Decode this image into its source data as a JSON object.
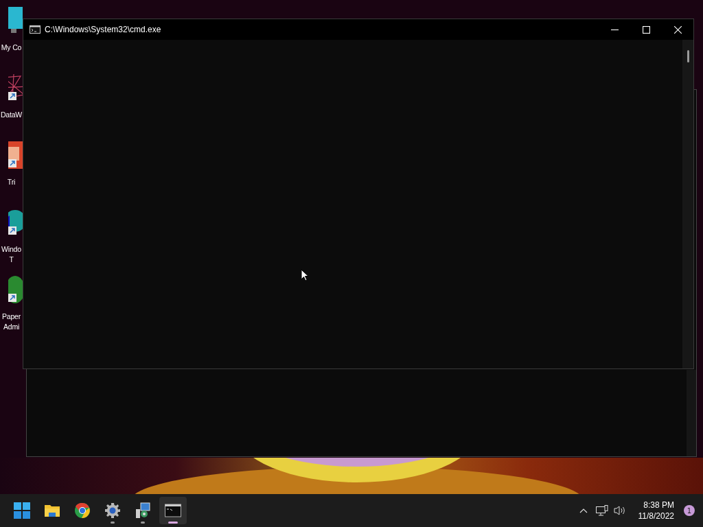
{
  "desktop_icons": [
    {
      "kind": "monitor",
      "shortcut": false,
      "lines": [
        "My Co"
      ]
    },
    {
      "kind": "network",
      "shortcut": true,
      "lines": [
        "DataW"
      ]
    },
    {
      "kind": "document",
      "shortcut": true,
      "lines": [
        "Tri"
      ]
    },
    {
      "kind": "globe",
      "shortcut": true,
      "lines": [
        "Windo",
        "T"
      ]
    },
    {
      "kind": "leaf",
      "shortcut": true,
      "lines": [
        "Paper",
        "Admi"
      ]
    }
  ],
  "window": {
    "title": "C:\\Windows\\System32\\cmd.exe"
  },
  "taskbar": {
    "apps": [
      {
        "kind": "start",
        "running": false,
        "selected": false
      },
      {
        "kind": "folder",
        "running": false,
        "selected": false
      },
      {
        "kind": "browser",
        "running": false,
        "selected": false
      },
      {
        "kind": "gear",
        "running": true,
        "selected": false
      },
      {
        "kind": "installer",
        "running": true,
        "selected": false
      },
      {
        "kind": "terminal",
        "running": true,
        "selected": true
      }
    ],
    "time": "8:38 PM",
    "date": "11/8/2022",
    "notifications": "1"
  }
}
